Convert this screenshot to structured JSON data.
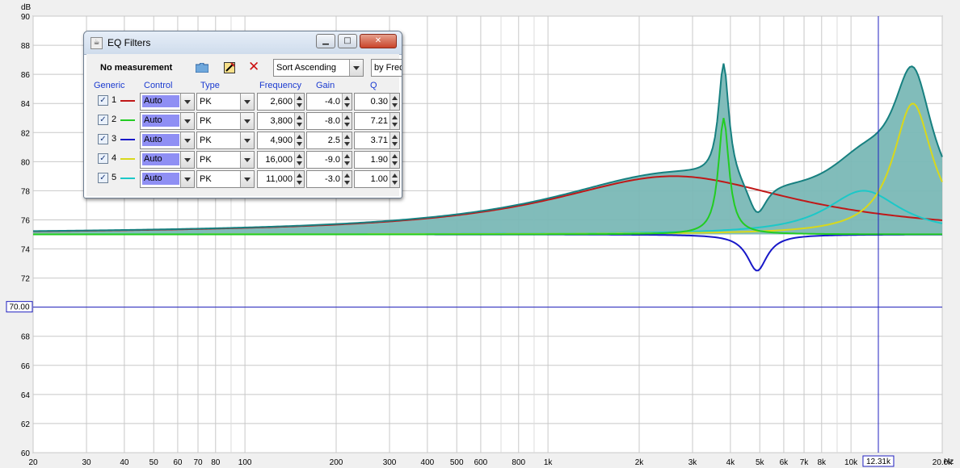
{
  "chart_data": {
    "type": "line",
    "y_unit": "dB",
    "x_unit": "Hz",
    "x_scale": "log",
    "xlim": [
      20,
      20000
    ],
    "ylim": [
      60,
      90
    ],
    "y_ticks": [
      90,
      88,
      86,
      84,
      82,
      80,
      78,
      76,
      74,
      72,
      70,
      68,
      66,
      64,
      62,
      60
    ],
    "y_tick_labels": [
      "90",
      "88",
      "86",
      "84",
      "82",
      "80",
      "78",
      "76",
      "74",
      "72",
      "",
      "68",
      "66",
      "64",
      "62",
      "60"
    ],
    "x_ticks": [
      {
        "v": 20,
        "label": "20"
      },
      {
        "v": 30,
        "label": "30"
      },
      {
        "v": 40,
        "label": "40"
      },
      {
        "v": 50,
        "label": "50"
      },
      {
        "v": 60,
        "label": "60"
      },
      {
        "v": 70,
        "label": "70"
      },
      {
        "v": 80,
        "label": "80"
      },
      {
        "v": 100,
        "label": "100"
      },
      {
        "v": 200,
        "label": "200"
      },
      {
        "v": 300,
        "label": "300"
      },
      {
        "v": 400,
        "label": "400"
      },
      {
        "v": 500,
        "label": "500"
      },
      {
        "v": 600,
        "label": "600"
      },
      {
        "v": 800,
        "label": "800"
      },
      {
        "v": 1000,
        "label": "1k"
      },
      {
        "v": 2000,
        "label": "2k"
      },
      {
        "v": 3000,
        "label": "3k"
      },
      {
        "v": 4000,
        "label": "4k"
      },
      {
        "v": 5000,
        "label": "5k"
      },
      {
        "v": 6000,
        "label": "6k"
      },
      {
        "v": 7000,
        "label": "7k"
      },
      {
        "v": 8000,
        "label": "8k"
      },
      {
        "v": 10000,
        "label": "10k"
      },
      {
        "v": 20000,
        "label": "20.0k"
      }
    ],
    "x_minor": [
      90,
      700,
      900,
      9000
    ],
    "cursor": {
      "x_label": "12.31k",
      "x_value": 12310,
      "y_label": "70.00",
      "y_value": 70
    },
    "baseline_db": 75,
    "series": [
      {
        "name": "1",
        "filter": "PK",
        "freq": 2600,
        "gain": 4.0,
        "q": 0.3,
        "color": "#c01818"
      },
      {
        "name": "2",
        "filter": "PK",
        "freq": 3800,
        "gain": 8.0,
        "q": 7.21,
        "color": "#22cc22"
      },
      {
        "name": "3",
        "filter": "PK",
        "freq": 4900,
        "gain": -2.5,
        "q": 3.71,
        "color": "#1818c8"
      },
      {
        "name": "4",
        "filter": "PK",
        "freq": 16000,
        "gain": 9.0,
        "q": 1.9,
        "color": "#d8d81c"
      },
      {
        "name": "5",
        "filter": "PK",
        "freq": 11000,
        "gain": 3.0,
        "q": 1.0,
        "color": "#1cc8c8"
      }
    ],
    "total_fill_color": "#7ab8b6",
    "total_line_color": "#178080"
  },
  "eq_window": {
    "title": "EQ Filters",
    "status": "No measurement",
    "sort_label": "Sort Ascending",
    "by_label": "by Frequency",
    "headers": {
      "generic": "Generic",
      "control": "Control",
      "type": "Type",
      "frequency": "Frequency",
      "gain": "Gain",
      "q": "Q"
    },
    "rows": [
      {
        "num": "1",
        "checked": "✓",
        "control": "Auto",
        "type": "PK",
        "frequency": "2,600",
        "gain": "-4.0",
        "q": "0.30",
        "color": "#c01818"
      },
      {
        "num": "2",
        "checked": "✓",
        "control": "Auto",
        "type": "PK",
        "frequency": "3,800",
        "gain": "-8.0",
        "q": "7.21",
        "color": "#22cc22"
      },
      {
        "num": "3",
        "checked": "✓",
        "control": "Auto",
        "type": "PK",
        "frequency": "4,900",
        "gain": "2.5",
        "q": "3.71",
        "color": "#1818c8"
      },
      {
        "num": "4",
        "checked": "✓",
        "control": "Auto",
        "type": "PK",
        "frequency": "16,000",
        "gain": "-9.0",
        "q": "1.90",
        "color": "#d8d81c"
      },
      {
        "num": "5",
        "checked": "✓",
        "control": "Auto",
        "type": "PK",
        "frequency": "11,000",
        "gain": "-3.0",
        "q": "1.00",
        "color": "#1cc8c8"
      }
    ]
  }
}
